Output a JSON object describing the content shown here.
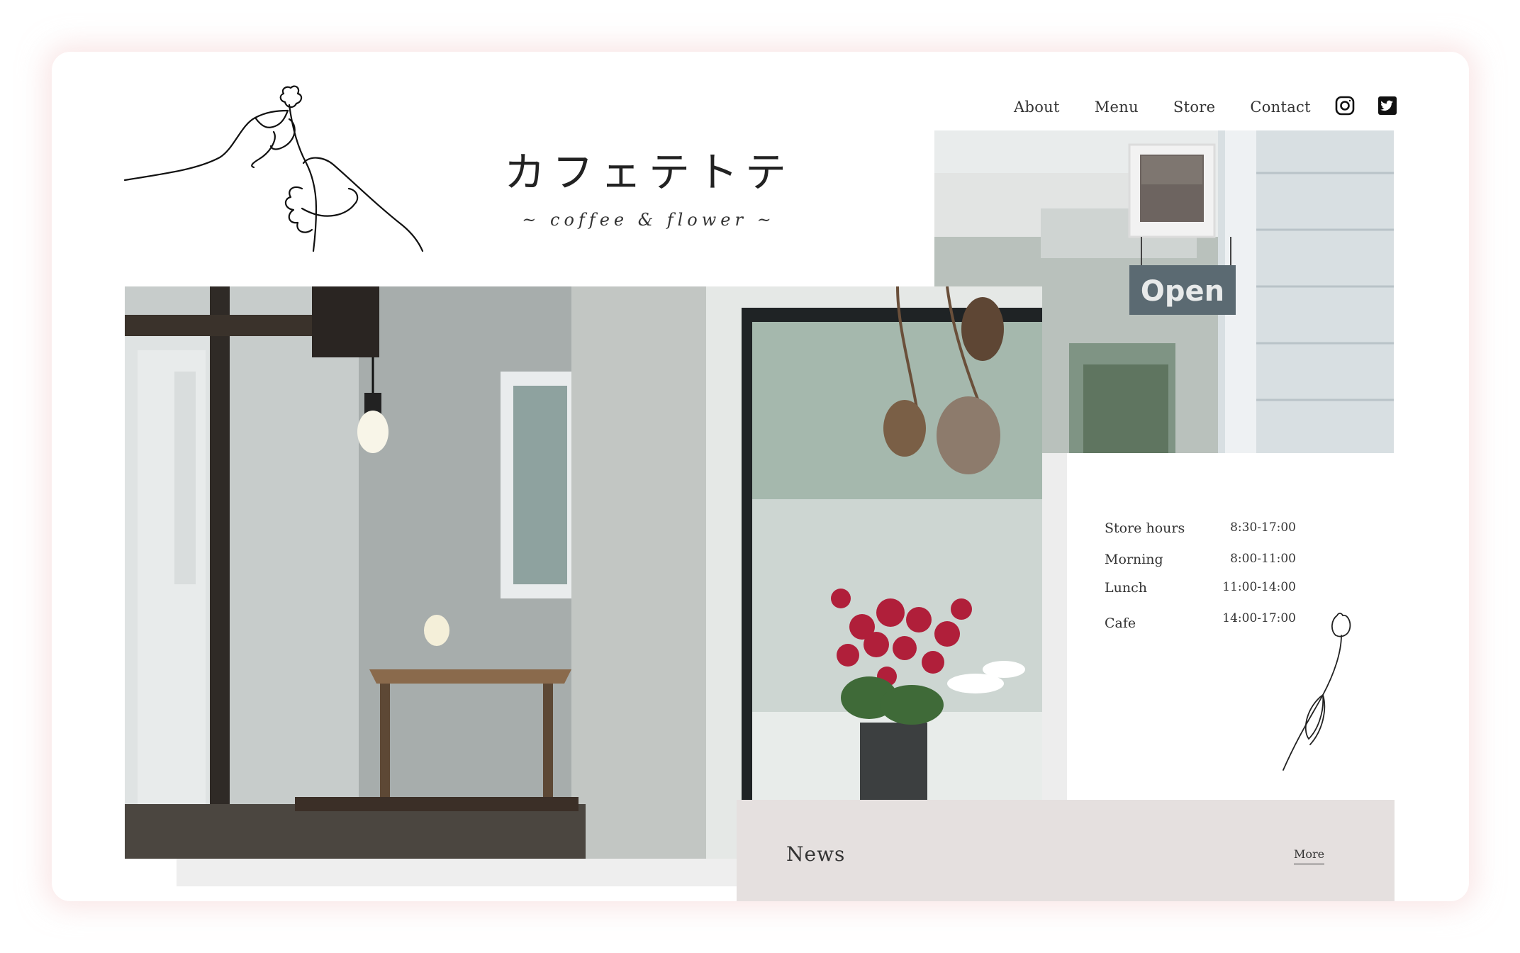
{
  "site": {
    "title": "カフェテトテ",
    "subtitle": "~ coffee & flower ~"
  },
  "nav": {
    "items": [
      {
        "label": "About"
      },
      {
        "label": "Menu"
      },
      {
        "label": "Store"
      },
      {
        "label": "Contact"
      }
    ],
    "social": [
      {
        "icon": "instagram-icon"
      },
      {
        "icon": "twitter-icon"
      }
    ]
  },
  "hero": {
    "main_photo": "cafe-interior-photo",
    "side_photo": "storefront-open-sign-photo",
    "sign_text": "Open"
  },
  "hours": {
    "rows": [
      {
        "label": "Store hours",
        "value": "8:30-17:00"
      },
      {
        "label": "Morning",
        "value": "8:00-11:00"
      },
      {
        "label": "Lunch",
        "value": "11:00-14:00"
      },
      {
        "label": "Cafe",
        "value": "14:00-17:00"
      }
    ]
  },
  "news": {
    "title": "News",
    "more": "More"
  },
  "colors": {
    "card_glow": "#f4d2d2",
    "news_bg": "#e5e0df",
    "text": "#2b2b2b"
  }
}
